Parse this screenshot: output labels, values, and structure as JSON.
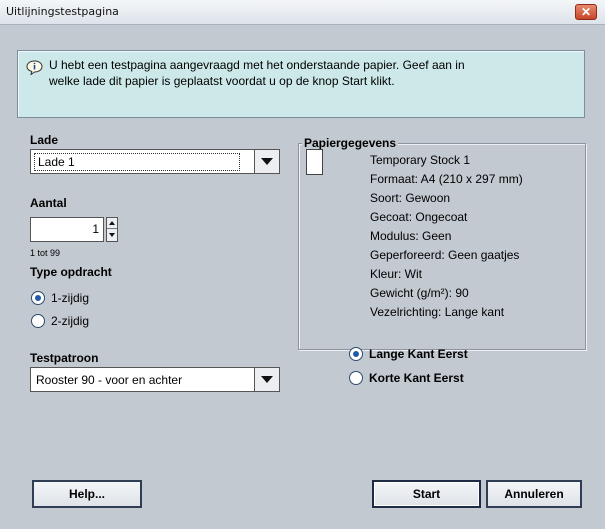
{
  "window": {
    "title": "Uitlijningstestpagina",
    "close_glyph": "✕"
  },
  "info": {
    "icon": "info-speech-icon",
    "line1": "U hebt een testpagina aangevraagd met het onderstaande papier.  Geef aan in",
    "line2": "welke lade dit papier is geplaatst voordat u op de knop Start klikt."
  },
  "tray": {
    "label": "Lade",
    "selected": "Lade 1"
  },
  "quantity": {
    "label": "Aantal",
    "value": "1",
    "range": "1 tot 99"
  },
  "job_type": {
    "label": "Type opdracht",
    "options": [
      "1-zijdig",
      "2-zijdig"
    ],
    "selected": "1-zijdig"
  },
  "pattern": {
    "label": "Testpatroon",
    "selected": "Rooster 90 - voor en achter"
  },
  "paper": {
    "group_title": "Papiergegevens",
    "lines": [
      "Temporary Stock 1",
      "Formaat: A4 (210 x 297 mm)",
      "Soort: Gewoon",
      "Gecoat: Ongecoat",
      "Modulus: Geen",
      "Geperforeerd: Geen gaatjes",
      "Kleur: Wit",
      "Gewicht (g/m²): 90",
      "Vezelrichting: Lange kant"
    ]
  },
  "feed_edge": {
    "options": [
      "Lange Kant Eerst",
      "Korte Kant Eerst"
    ],
    "selected": "Lange Kant Eerst"
  },
  "buttons": {
    "help": "Help...",
    "start": "Start",
    "cancel": "Annuleren"
  },
  "colors": {
    "dialog_bg": "#c3c9d1",
    "info_bg": "#cce8e8",
    "close_button": "#c8452a",
    "radio_selected": "#1e5aa8"
  }
}
